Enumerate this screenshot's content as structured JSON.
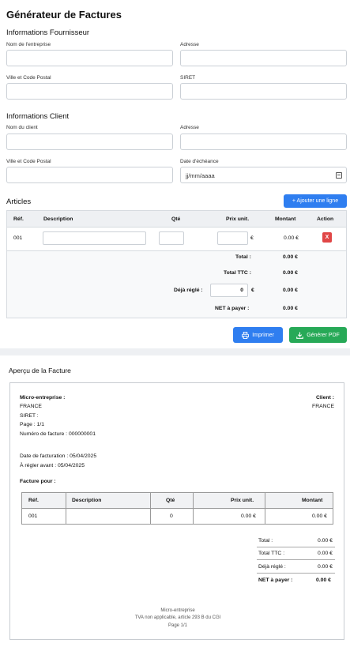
{
  "form": {
    "title": "Générateur de Factures",
    "supplier_section": "Informations Fournisseur",
    "supplier": {
      "company_label": "Nom de l'entreprise",
      "address_label": "Adresse",
      "city_label": "Ville et Code Postal",
      "siret_label": "SIRET"
    },
    "client_section": "Informations Client",
    "client": {
      "name_label": "Nom du client",
      "address_label": "Adresse",
      "city_label": "Ville et Code Postal",
      "due_label": "Date d'échéance",
      "due_placeholder": "jj/mm/aaaa"
    },
    "articles_title": "Articles",
    "add_line_label": "+ Ajouter une ligne",
    "table": {
      "headers": [
        "Réf.",
        "Description",
        "Qté",
        "Prix unit.",
        "Montant",
        "Action"
      ],
      "row": {
        "ref": "001",
        "currency": "€",
        "amount": "0.00 €",
        "delete": "X"
      },
      "total_label": "Total :",
      "total_value": "0.00 €",
      "ttc_label": "Total TTC :",
      "ttc_value": "0.00 €",
      "paid_label": "Déjà réglé :",
      "paid_input": "0",
      "paid_currency": "€",
      "paid_value": "0.00 €",
      "net_label": "NET à payer :",
      "net_value": "0.00 €"
    },
    "print_label": "Imprimer",
    "pdf_label": "Générer PDF"
  },
  "preview": {
    "title": "Aperçu de la Facture",
    "supplier_heading": "Micro-entreprise :",
    "supplier_country": "FRANCE",
    "siret": "SIRET :",
    "page": "Page : 1/1",
    "invoice_number": "Numéro de facture : 000000001",
    "invoice_date": "Date de facturation : 05/04/2025",
    "due_date": "À régler avant : 05/04/2025",
    "client_heading": "Client :",
    "client_country": "FRANCE",
    "bill_to": "Facture pour :",
    "headers": [
      "Réf.",
      "Description",
      "Qté",
      "Prix unit.",
      "Montant"
    ],
    "row": {
      "ref": "001",
      "description": "",
      "qty": "0",
      "price": "0.00 €",
      "amount": "0.00 €"
    },
    "totals": [
      {
        "label": "Total :",
        "value": "0.00 €"
      },
      {
        "label": "Total TTC :",
        "value": "0.00 €"
      },
      {
        "label": "Déjà réglé :",
        "value": "0.00 €"
      },
      {
        "label": "NET à payer :",
        "value": "0.00 €"
      }
    ],
    "footer": [
      "Micro-entreprise",
      "TVA non applicable, article 293 B du CGI",
      "Page 1/1"
    ]
  },
  "colors": {
    "primary": "#2f7ef0",
    "success": "#27a957",
    "danger": "#e04646"
  },
  "icons": {
    "print": "printer-icon",
    "pdf": "download-icon",
    "date": "calendar-icon"
  }
}
